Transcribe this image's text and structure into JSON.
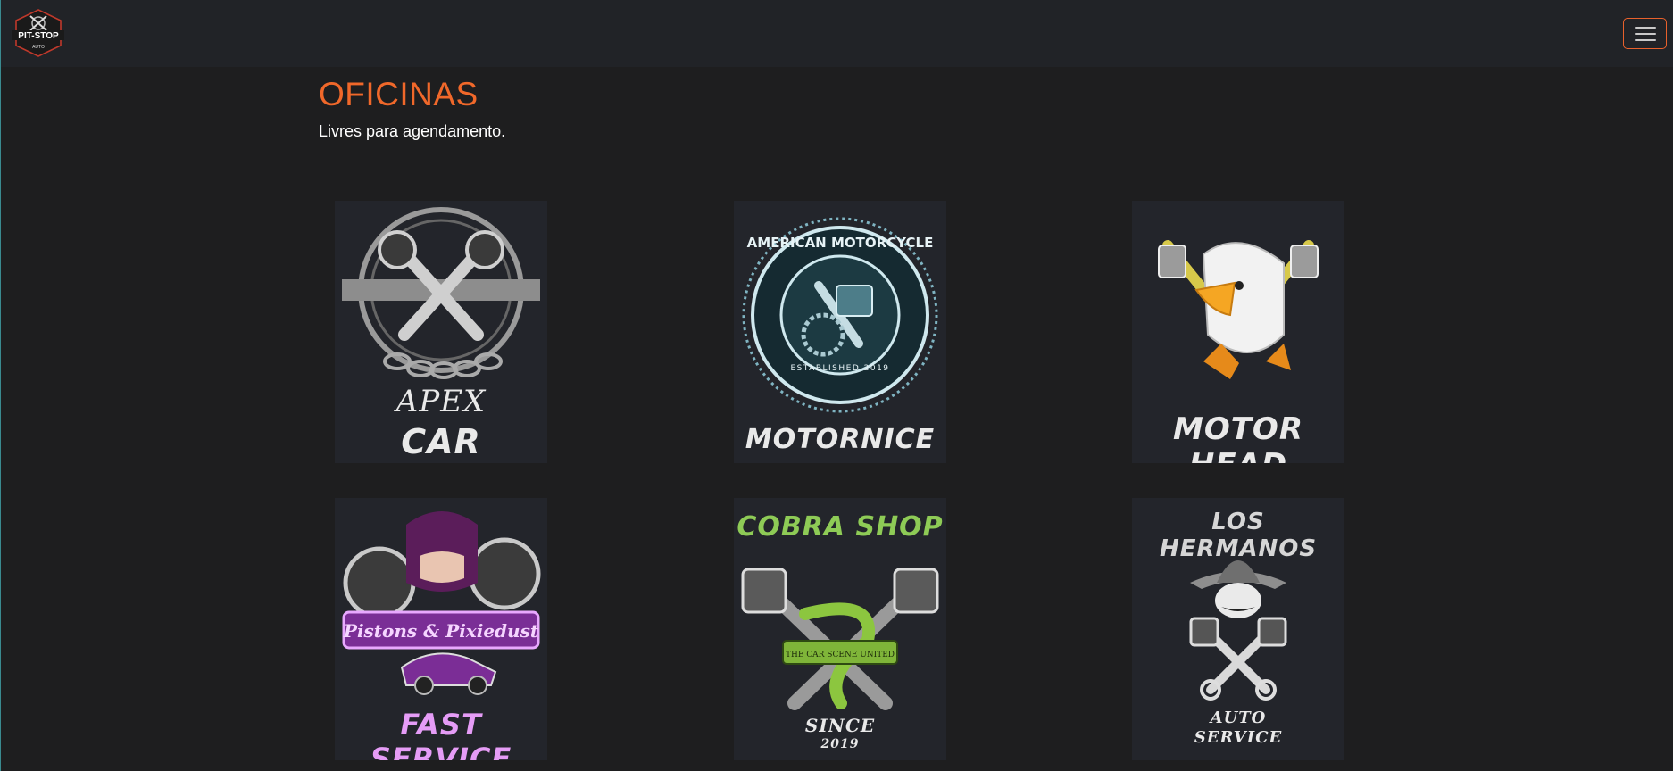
{
  "nav": {
    "logo_text": "PIT-STOP",
    "logo_sub": "AUTO"
  },
  "header": {
    "title": "OFICINAS",
    "subtitle": "Livres para agendamento."
  },
  "shops": [
    {
      "name_line1": "APEX",
      "name_line2": "CAR",
      "badge": ""
    },
    {
      "name_line1": "MOTORNICE",
      "badge": "AMERICAN MOTORCYCLE",
      "badge_sub": "ESTABLISHED 2019"
    },
    {
      "name_line1": "MOTOR HEAD"
    },
    {
      "name_line1": "FAST SERVICE",
      "badge": "Pistons & Pixiedust"
    },
    {
      "name_line1": "COBRA SHOP",
      "badge": "THE CAR SCENE UNITED",
      "name_line2": "SINCE",
      "name_line3": "2019"
    },
    {
      "name_line1": "LOS HERMANOS",
      "name_line2": "AUTO",
      "name_line3": "SERVICE"
    }
  ],
  "colors": {
    "accent": "#f0682a",
    "background": "#1e1e1f",
    "navbar": "#212327",
    "card": "#23252b"
  }
}
